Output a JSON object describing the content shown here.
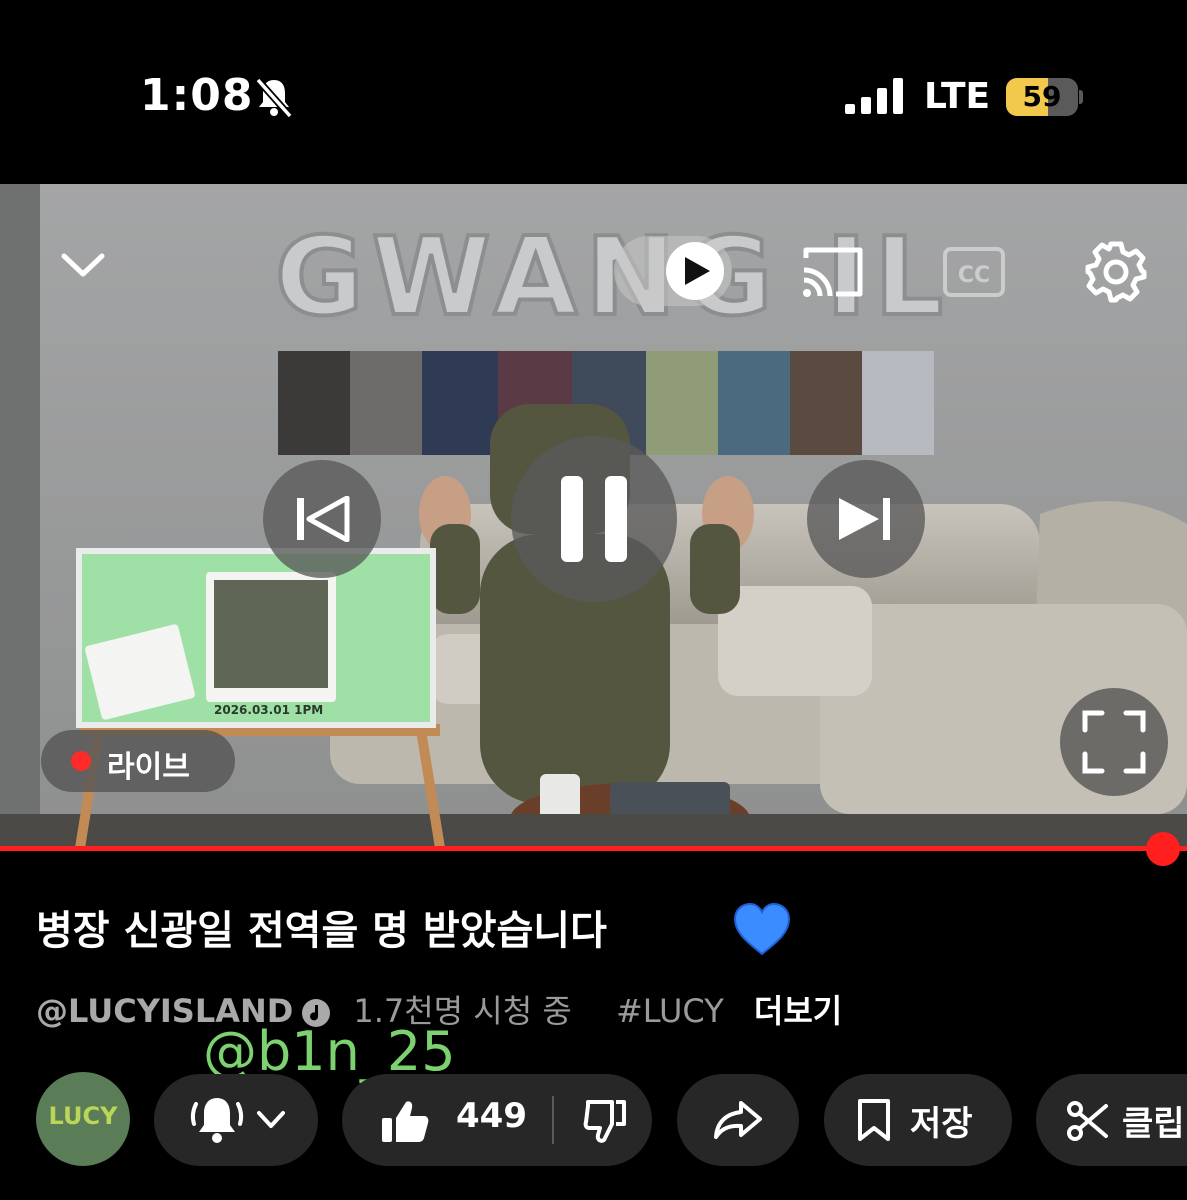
{
  "status_bar": {
    "time": "1:08",
    "network": "LTE",
    "battery": "59",
    "battery_level": 0.59
  },
  "player": {
    "live_label": "라이브",
    "progress": 1.0,
    "accent_color": "#ff1f1f"
  },
  "video": {
    "title": "병장 신광일 전역을 명 받았습니다",
    "channel": "@LUCYISLAND",
    "viewers": "1.7천명 시청 중",
    "hashtag": "#LUCY",
    "more_label": "더보기",
    "watermark": "@b1n_25"
  },
  "scene": {
    "balloon_text": "GWANG IL",
    "screen_date": "2026.03.01 1PM"
  },
  "actions": {
    "avatar_text": "LUCY",
    "like_count": "449",
    "save_label": "저장",
    "clip_label": "클립"
  }
}
